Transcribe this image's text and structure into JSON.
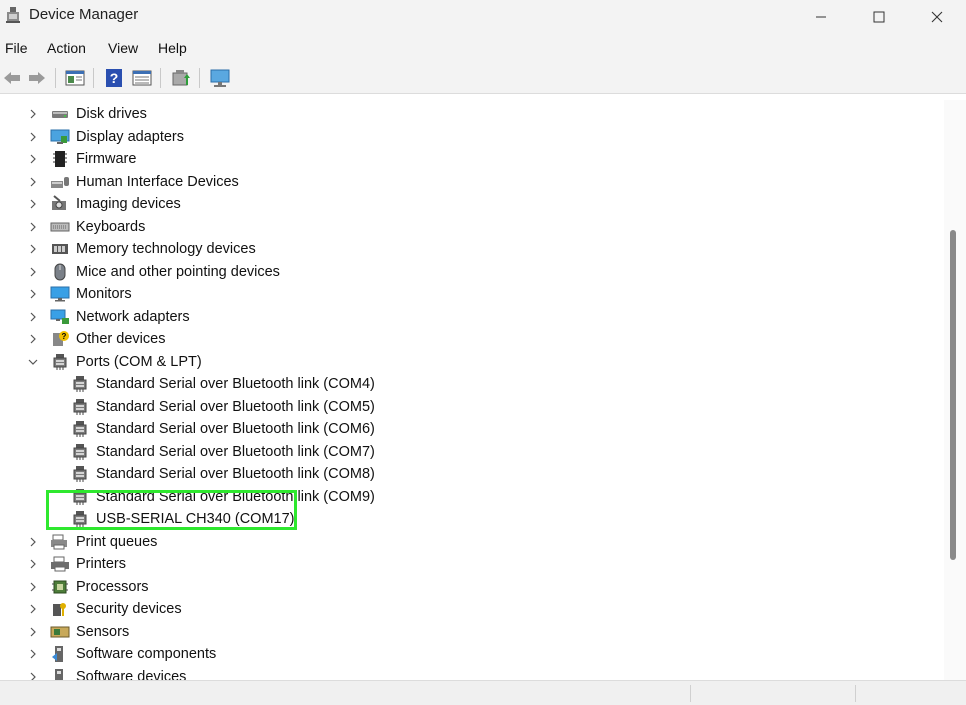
{
  "window": {
    "title": "Device Manager"
  },
  "menu": [
    "File",
    "Action",
    "View",
    "Help"
  ],
  "toolbar": [
    "back-icon",
    "forward-icon",
    "properties-window-icon",
    "help-icon",
    "details-view-icon",
    "update-driver-icon",
    "scan-hardware-icon"
  ],
  "tree": {
    "items": [
      {
        "label": "Disk drives",
        "icon": "disk-drive-icon",
        "expanded": false,
        "depth": 0
      },
      {
        "label": "Display adapters",
        "icon": "display-adapter-icon",
        "expanded": false,
        "depth": 0
      },
      {
        "label": "Firmware",
        "icon": "firmware-icon",
        "expanded": false,
        "depth": 0
      },
      {
        "label": "Human Interface Devices",
        "icon": "hid-icon",
        "expanded": false,
        "depth": 0
      },
      {
        "label": "Imaging devices",
        "icon": "camera-icon",
        "expanded": false,
        "depth": 0
      },
      {
        "label": "Keyboards",
        "icon": "keyboard-icon",
        "expanded": false,
        "depth": 0
      },
      {
        "label": "Memory technology devices",
        "icon": "memory-icon",
        "expanded": false,
        "depth": 0
      },
      {
        "label": "Mice and other pointing devices",
        "icon": "mouse-icon",
        "expanded": false,
        "depth": 0
      },
      {
        "label": "Monitors",
        "icon": "monitor-icon",
        "expanded": false,
        "depth": 0
      },
      {
        "label": "Network adapters",
        "icon": "network-icon",
        "expanded": false,
        "depth": 0
      },
      {
        "label": "Other devices",
        "icon": "unknown-device-icon",
        "expanded": false,
        "depth": 0
      },
      {
        "label": "Ports (COM & LPT)",
        "icon": "port-icon",
        "expanded": true,
        "depth": 0
      },
      {
        "label": "Standard Serial over Bluetooth link (COM4)",
        "icon": "port-icon",
        "depth": 1
      },
      {
        "label": "Standard Serial over Bluetooth link (COM5)",
        "icon": "port-icon",
        "depth": 1
      },
      {
        "label": "Standard Serial over Bluetooth link (COM6)",
        "icon": "port-icon",
        "depth": 1
      },
      {
        "label": "Standard Serial over Bluetooth link (COM7)",
        "icon": "port-icon",
        "depth": 1
      },
      {
        "label": "Standard Serial over Bluetooth link (COM8)",
        "icon": "port-icon",
        "depth": 1
      },
      {
        "label": "Standard Serial over Bluetooth link (COM9)",
        "icon": "port-icon",
        "depth": 1
      },
      {
        "label": "USB-SERIAL CH340 (COM17)",
        "icon": "port-icon",
        "depth": 1,
        "highlighted": true
      },
      {
        "label": "Print queues",
        "icon": "print-queue-icon",
        "expanded": false,
        "depth": 0
      },
      {
        "label": "Printers",
        "icon": "printer-icon",
        "expanded": false,
        "depth": 0
      },
      {
        "label": "Processors",
        "icon": "processor-icon",
        "expanded": false,
        "depth": 0
      },
      {
        "label": "Security devices",
        "icon": "security-device-icon",
        "expanded": false,
        "depth": 0
      },
      {
        "label": "Sensors",
        "icon": "sensor-icon",
        "expanded": false,
        "depth": 0
      },
      {
        "label": "Software components",
        "icon": "software-component-icon",
        "expanded": false,
        "depth": 0
      },
      {
        "label": "Software devices",
        "icon": "software-device-icon",
        "expanded": false,
        "depth": 0
      }
    ]
  },
  "colors": {
    "highlight": "#2ee82e",
    "accent": "#1f7fd6"
  }
}
